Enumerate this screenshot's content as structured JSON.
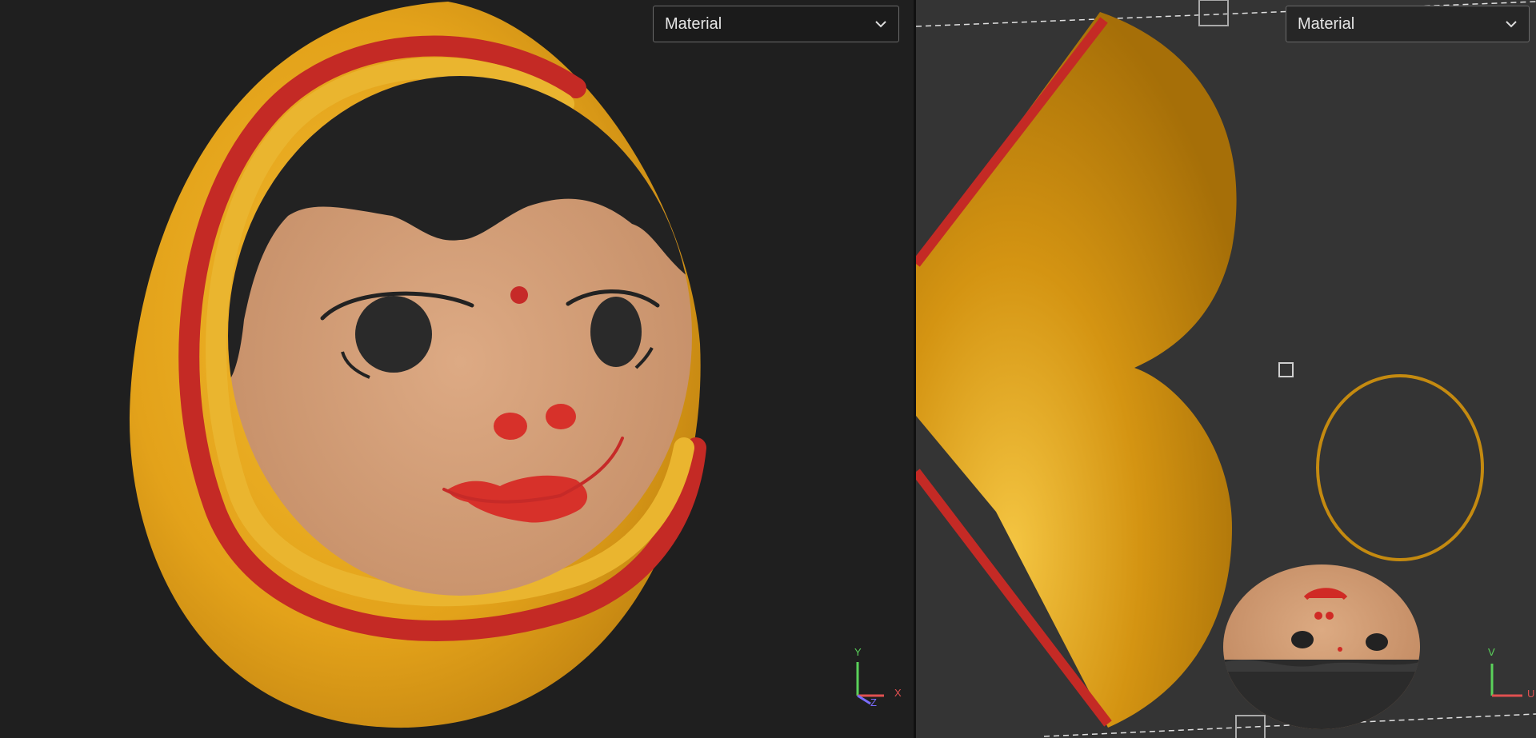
{
  "viewport_3d": {
    "dropdown": {
      "value": "Material"
    },
    "axis_gizmo": {
      "y_label": "Y",
      "x_label": "X",
      "z_label": "Z"
    }
  },
  "viewport_2d": {
    "dropdown": {
      "value": "Material"
    },
    "axis_gizmo": {
      "v_label": "V",
      "u_label": "U"
    }
  },
  "colors": {
    "viewport_3d_bg": "#1f1f1f",
    "viewport_2d_bg": "#343434",
    "egg_yellow": "#e8a81c",
    "stripe_red": "#c42a25",
    "skin": "#d8a07a",
    "hair": "#222222",
    "uv_gold": "#d49412"
  }
}
